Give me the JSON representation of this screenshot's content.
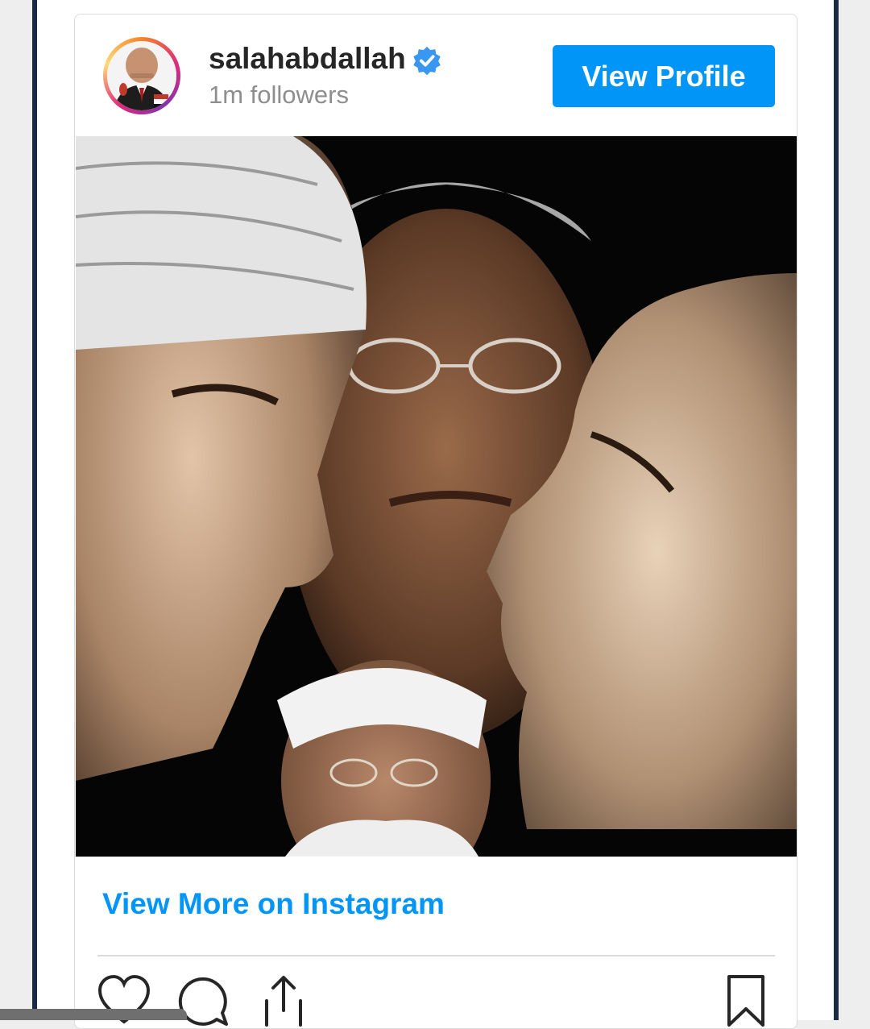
{
  "header": {
    "username": "salahabdallah",
    "followers": "1m followers",
    "view_profile_label": "View Profile",
    "verified_icon": "verified-badge-icon"
  },
  "post": {
    "image_description_icon": "post-image-collage"
  },
  "footer": {
    "view_more_label": "View More on Instagram",
    "actions": [
      "heart-icon",
      "comment-icon",
      "share-icon",
      "bookmark-icon"
    ]
  },
  "colors": {
    "accent": "#0095f6",
    "text_primary": "#262626",
    "text_secondary": "#8e8e8e",
    "frame": "#1c2b45"
  }
}
